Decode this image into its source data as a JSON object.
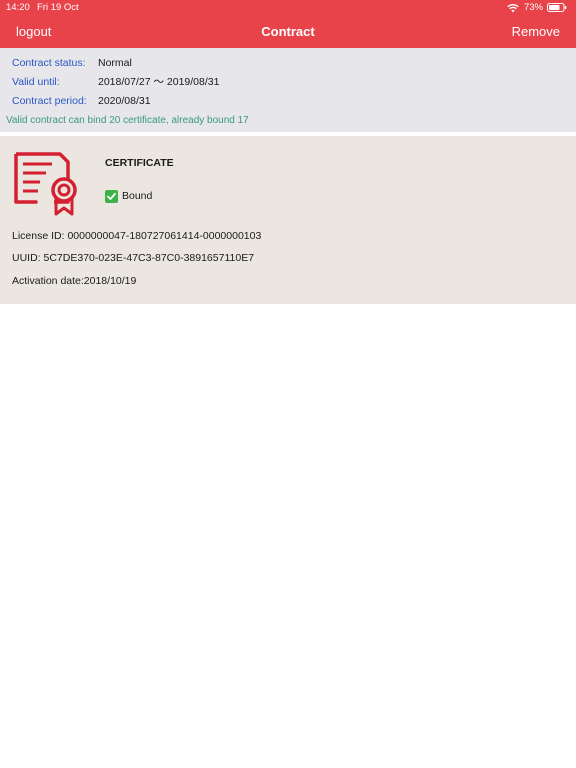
{
  "status_bar": {
    "time": "14:20",
    "date": "Fri 19 Oct",
    "battery": "73%"
  },
  "nav": {
    "logout_label": "logout",
    "title": "Contract",
    "remove_label": "Remove"
  },
  "contract": {
    "status_label": "Contract status:",
    "status_value": "Normal",
    "valid_label": "Valid until:",
    "valid_value": "2018/07/27 ～ 2019/08/31",
    "period_label": "Contract period:",
    "period_value": "2020/08/31",
    "note": "Valid contract can bind 20 certificate, already bound 17"
  },
  "certificate": {
    "title": "CERTIFICATE",
    "status": "Bound",
    "license_id": "License ID: 0000000047-180727061414-0000000103",
    "uuid": "UUID: 5C7DE370-023E-47C3-87C0-3891657110E7",
    "activation_date": "Activation date:2018/10/19"
  },
  "colors": {
    "header": "#e8434a",
    "label_blue": "#2b55c6",
    "note_green": "#3a9a7a",
    "icon_red": "#d42030",
    "check_green": "#3bb34a"
  },
  "icons": {
    "wifi": "wifi-icon",
    "battery": "battery-icon",
    "certificate": "certificate-icon",
    "check": "check-icon"
  }
}
